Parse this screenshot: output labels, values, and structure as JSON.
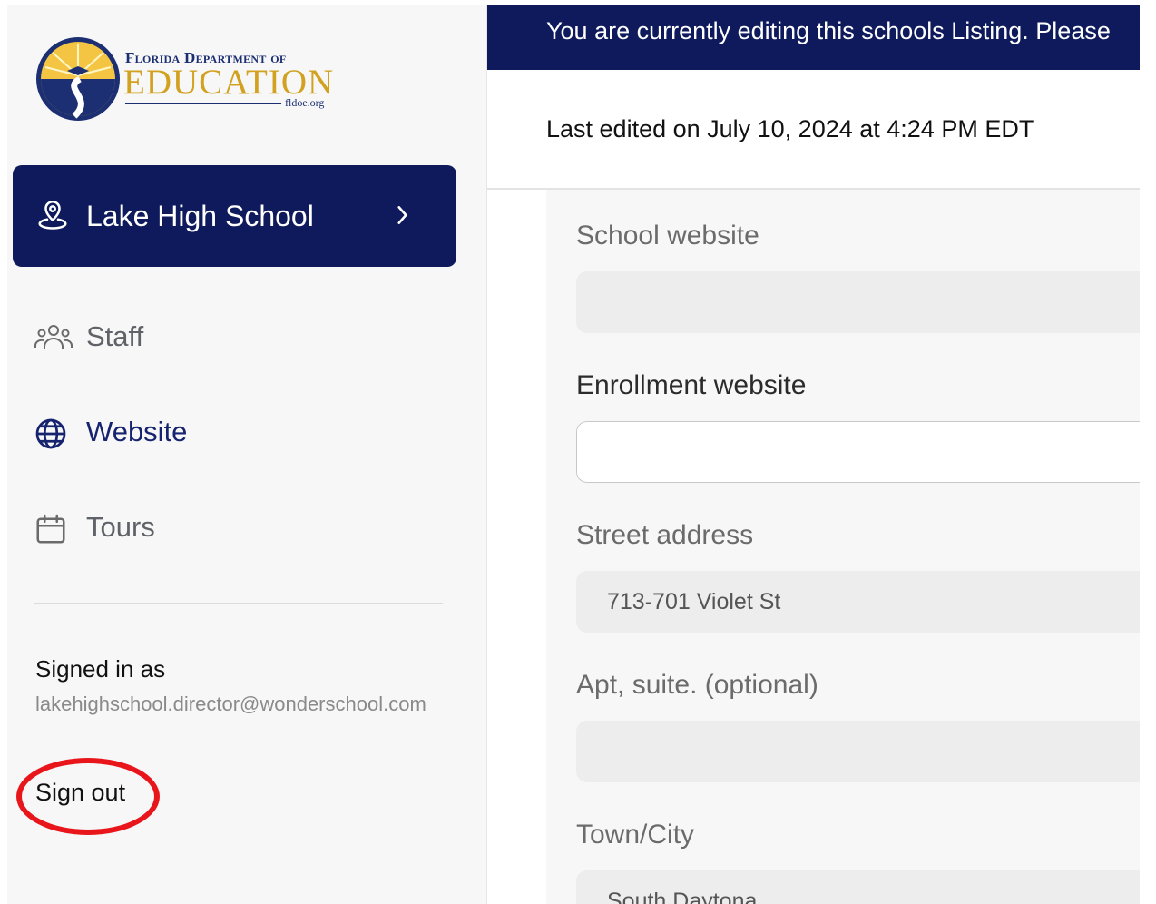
{
  "logo": {
    "line1": "Florida Department of",
    "line2": "EDUCATION",
    "line3": "fldoe.org"
  },
  "sidebar": {
    "school": {
      "label": "Lake High School",
      "icon": "map-pin-icon"
    },
    "items": [
      {
        "label": "Staff",
        "icon": "people-icon",
        "active": false
      },
      {
        "label": "Website",
        "icon": "globe-icon",
        "active": true
      },
      {
        "label": "Tours",
        "icon": "calendar-icon",
        "active": false
      }
    ],
    "signed_in_label": "Signed in as",
    "signed_in_email": "lakehighschool.director@wonderschool.com",
    "sign_out": "Sign out"
  },
  "banner": {
    "text": "You are currently editing this schools Listing. Please"
  },
  "last_edited": "Last edited on July 10, 2024 at 4:24 PM EDT",
  "form": {
    "fields": [
      {
        "label": "School website",
        "value": "",
        "editable": false
      },
      {
        "label": "Enrollment website",
        "value": "",
        "editable": true
      },
      {
        "label": "Street address",
        "value": "713-701 Violet St",
        "editable": false
      },
      {
        "label": "Apt, suite. (optional)",
        "value": "",
        "editable": false
      },
      {
        "label": "Town/City",
        "value": "South Daytona",
        "editable": false
      }
    ]
  },
  "colors": {
    "navy": "#0e1a5c",
    "annotation_red": "#e8161b",
    "gold": "#d1a11f"
  }
}
